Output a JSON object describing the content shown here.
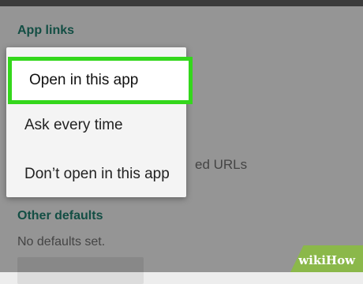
{
  "settings": {
    "app_links_header": "App links",
    "urls_fragment": "ed URLs",
    "other_defaults_header": "Other defaults",
    "no_defaults_text": "No defaults set."
  },
  "menu": {
    "items": [
      {
        "label": "Open in this app",
        "selected": true
      },
      {
        "label": "Ask every time",
        "selected": false
      },
      {
        "label": "Don’t open in this app",
        "selected": false
      }
    ]
  },
  "watermark": {
    "text": "wikiHow"
  },
  "colors": {
    "highlight": "#34d71c",
    "section_header": "#1f7f6e",
    "watermark_bg": "#8bb84a"
  }
}
